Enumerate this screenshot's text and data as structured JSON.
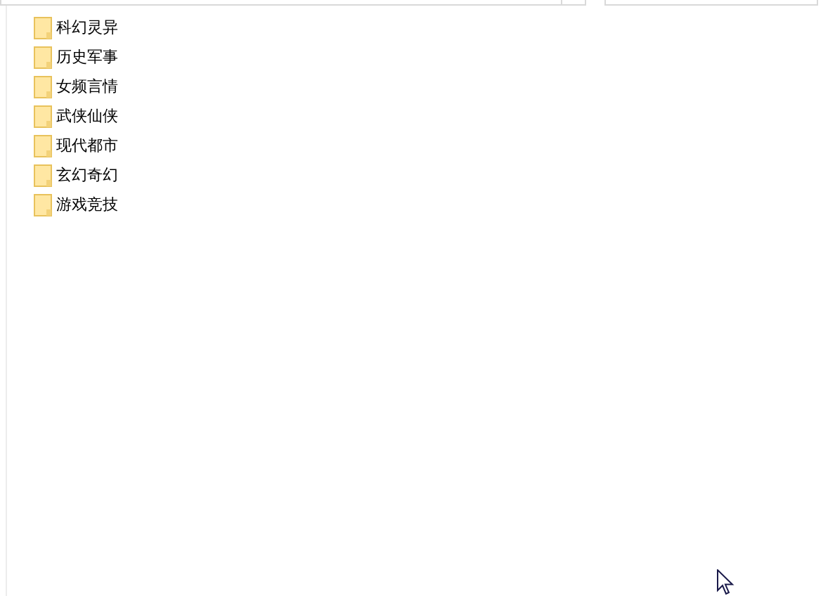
{
  "folders": [
    {
      "name": "科幻灵异"
    },
    {
      "name": "历史军事"
    },
    {
      "name": "女频言情"
    },
    {
      "name": "武侠仙侠"
    },
    {
      "name": "现代都市"
    },
    {
      "name": "玄幻奇幻"
    },
    {
      "name": "游戏竞技"
    }
  ]
}
